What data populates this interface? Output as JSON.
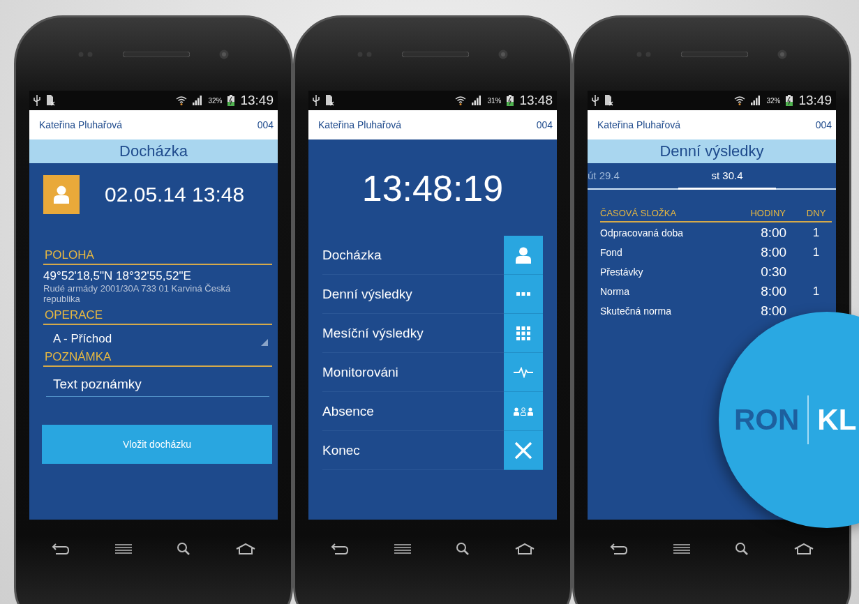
{
  "phones": [
    {
      "status_bar": {
        "battery": "32%",
        "time": "13:49"
      },
      "header": {
        "user": "Kateřina Pluhařová",
        "code": "004"
      },
      "screen": {
        "kind": "attendance",
        "title": "Docházka",
        "datetime": "02.05.14 13:48",
        "location_label": "POLOHA",
        "coordinates": "49°52'18,5\"N 18°32'55,52\"E",
        "address": "Rudé armády 2001/30A 733 01 Karviná Česká republika",
        "operation_label": "OPERACE",
        "operation_value": "A - Příchod",
        "note_label": "POZNÁMKA",
        "note_placeholder": "Text poznámky",
        "submit_button": "Vložit docházku"
      }
    },
    {
      "status_bar": {
        "battery": "31%",
        "time": "13:48"
      },
      "header": {
        "user": "Kateřina Pluhařová",
        "code": "004"
      },
      "screen": {
        "kind": "menu",
        "clock": "13:48:19",
        "items": [
          {
            "label": "Docházka"
          },
          {
            "label": "Denní výsledky"
          },
          {
            "label": "Mesíční výsledky"
          },
          {
            "label": "Monitorováni"
          },
          {
            "label": "Absence"
          },
          {
            "label": "Konec"
          }
        ]
      }
    },
    {
      "status_bar": {
        "battery": "32%",
        "time": "13:49"
      },
      "header": {
        "user": "Kateřina Pluhařová",
        "code": "004"
      },
      "screen": {
        "kind": "daily_results",
        "title": "Denní výsledky",
        "tabs": [
          {
            "label": "út 29.4",
            "selected": false
          },
          {
            "label": "st 30.4",
            "selected": true
          }
        ],
        "columns": [
          "ČASOVÁ SLOŽKA",
          "HODINY",
          "DNY"
        ],
        "rows": [
          {
            "name": "Odpracovaná doba",
            "hours": "8:00",
            "days": "1"
          },
          {
            "name": "Fond",
            "hours": "8:00",
            "days": "1"
          },
          {
            "name": "Přestávky",
            "hours": "0:30"
          },
          {
            "name": "Norma",
            "hours": "8:00",
            "days": "1"
          },
          {
            "name": "Skutečná norma",
            "hours": "8:00"
          }
        ]
      }
    }
  ],
  "logo": {
    "left": "RON",
    "right": "KL"
  }
}
